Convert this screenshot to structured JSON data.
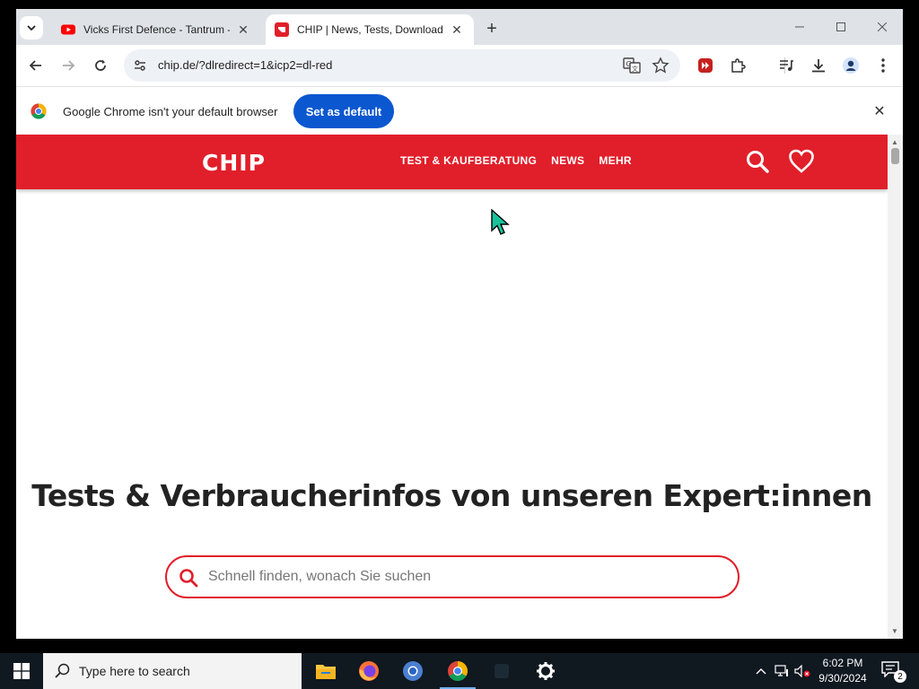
{
  "browser": {
    "tabs": [
      {
        "title": "Vicks First Defence - Tantrum -",
        "favicon": "youtube-icon",
        "active": false
      },
      {
        "title": "CHIP | News, Tests, Downloads",
        "favicon": "chip-icon",
        "active": true
      }
    ],
    "url": "chip.de/?dlredirect=1&icp2=dl-red"
  },
  "infobar": {
    "message": "Google Chrome isn't your default browser",
    "button": "Set as default"
  },
  "site": {
    "logo": "CHIP",
    "nav": [
      "TEST & KAUFBERATUNG",
      "NEWS",
      "MEHR"
    ],
    "headline": "Tests & Verbraucherinfos von unseren Expert:innen",
    "search_placeholder": "Schnell finden, wonach Sie suchen",
    "brand_color": "#e11f2a"
  },
  "taskbar": {
    "search_text": "Type here to search",
    "time": "6:02 PM",
    "date": "9/30/2024",
    "notification_count": "2"
  }
}
